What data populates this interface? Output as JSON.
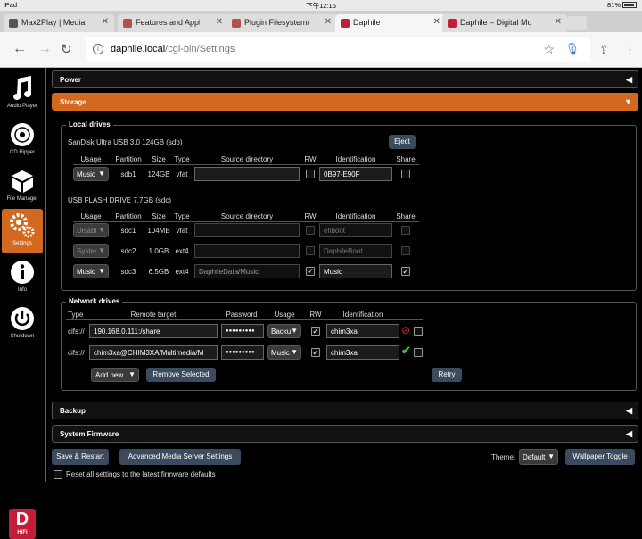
{
  "status_bar": {
    "device": "iPad",
    "time": "下午12:16",
    "battery": "81%"
  },
  "browser": {
    "tabs": [
      {
        "title": "Max2Play | Media S",
        "color": "#555555"
      },
      {
        "title": "Features and Applic",
        "color": "#b05050"
      },
      {
        "title": "Plugin Filesystem/",
        "color": "#b05050"
      },
      {
        "title": "Daphile",
        "color": "#c41d3a"
      },
      {
        "title": "Daphile – Digital Mu",
        "color": "#c41d3a"
      }
    ],
    "url_host": "daphile.local",
    "url_path": "/cgi-bin/Settings"
  },
  "sidebar": {
    "items": [
      {
        "label": "Audio Player",
        "icon": "music-note-icon"
      },
      {
        "label": "CD Ripper",
        "icon": "cd-icon"
      },
      {
        "label": "File Manager",
        "icon": "box-icon"
      },
      {
        "label": "Settings",
        "icon": "gears-icon"
      },
      {
        "label": "Info",
        "icon": "info-icon"
      },
      {
        "label": "Shutdown",
        "icon": "power-icon"
      }
    ],
    "logo_text": "D",
    "logo_sub": "HiFi"
  },
  "sections": {
    "power": "Power",
    "storage": "Storage",
    "backup": "Backup",
    "system_firmware": "System Firmware"
  },
  "local_drives": {
    "legend": "Local drives",
    "drive1": {
      "name": "SanDisk Ultra USB 3.0 124GB (sdb)",
      "eject": "Eject",
      "headers": [
        "Usage",
        "Partition",
        "Size",
        "Type",
        "Source directory",
        "RW",
        "Identification",
        "Share"
      ],
      "rows": [
        {
          "usage": "Music",
          "partition": "sdb1",
          "size": "124GB",
          "type": "vfat",
          "source": "",
          "rw": false,
          "id": "0B97-E90F",
          "share": false
        }
      ]
    },
    "drive2": {
      "name": "USB FLASH DRIVE 7.7GB (sdc)",
      "headers": [
        "Usage",
        "Partition",
        "Size",
        "Type",
        "Source directory",
        "RW",
        "Identification",
        "Share"
      ],
      "rows": [
        {
          "usage": "Disabl",
          "partition": "sdc1",
          "size": "104MB",
          "type": "vfat",
          "source": "",
          "rw": false,
          "id": "efiboot",
          "share": false
        },
        {
          "usage": "Syster",
          "partition": "sdc2",
          "size": "1.0GB",
          "type": "ext4",
          "source": "",
          "rw": false,
          "id": "DaphileBoot",
          "share": false
        },
        {
          "usage": "Music",
          "partition": "sdc3",
          "size": "6.5GB",
          "type": "ext4",
          "source": "DaphileData/Music",
          "rw": true,
          "id": "Music",
          "share": true
        }
      ]
    }
  },
  "network_drives": {
    "legend": "Network drives",
    "headers": [
      "Type",
      "Remote target",
      "Password",
      "Usage",
      "RW",
      "Identification"
    ],
    "rows": [
      {
        "type": "cifs://",
        "target": "190.168.0.111:/share",
        "password": "●●●●●●●●●",
        "usage": "Backu",
        "rw": true,
        "id": "chim3xa",
        "status": "error",
        "share": false
      },
      {
        "type": "cifs://",
        "target": "chim3xa@CHIM3XA/Multimedia/M",
        "password": "●●●●●●●●●",
        "usage": "Music",
        "rw": true,
        "id": "chim3xa",
        "status": "ok",
        "share": false
      }
    ],
    "add_new": "Add new",
    "remove_selected": "Remove Selected",
    "retry": "Retry"
  },
  "footer": {
    "save_restart": "Save & Restart",
    "advanced": "Advanced Media Server Settings",
    "theme_label": "Theme:",
    "theme_value": "Default",
    "wallpaper": "Wallpaper Toggle",
    "reset_label": "Reset all settings to the latest firmware defaults"
  },
  "colors": {
    "accent": "#d2691e",
    "button": "#3b4a5c",
    "logo": "#c41d3a"
  }
}
